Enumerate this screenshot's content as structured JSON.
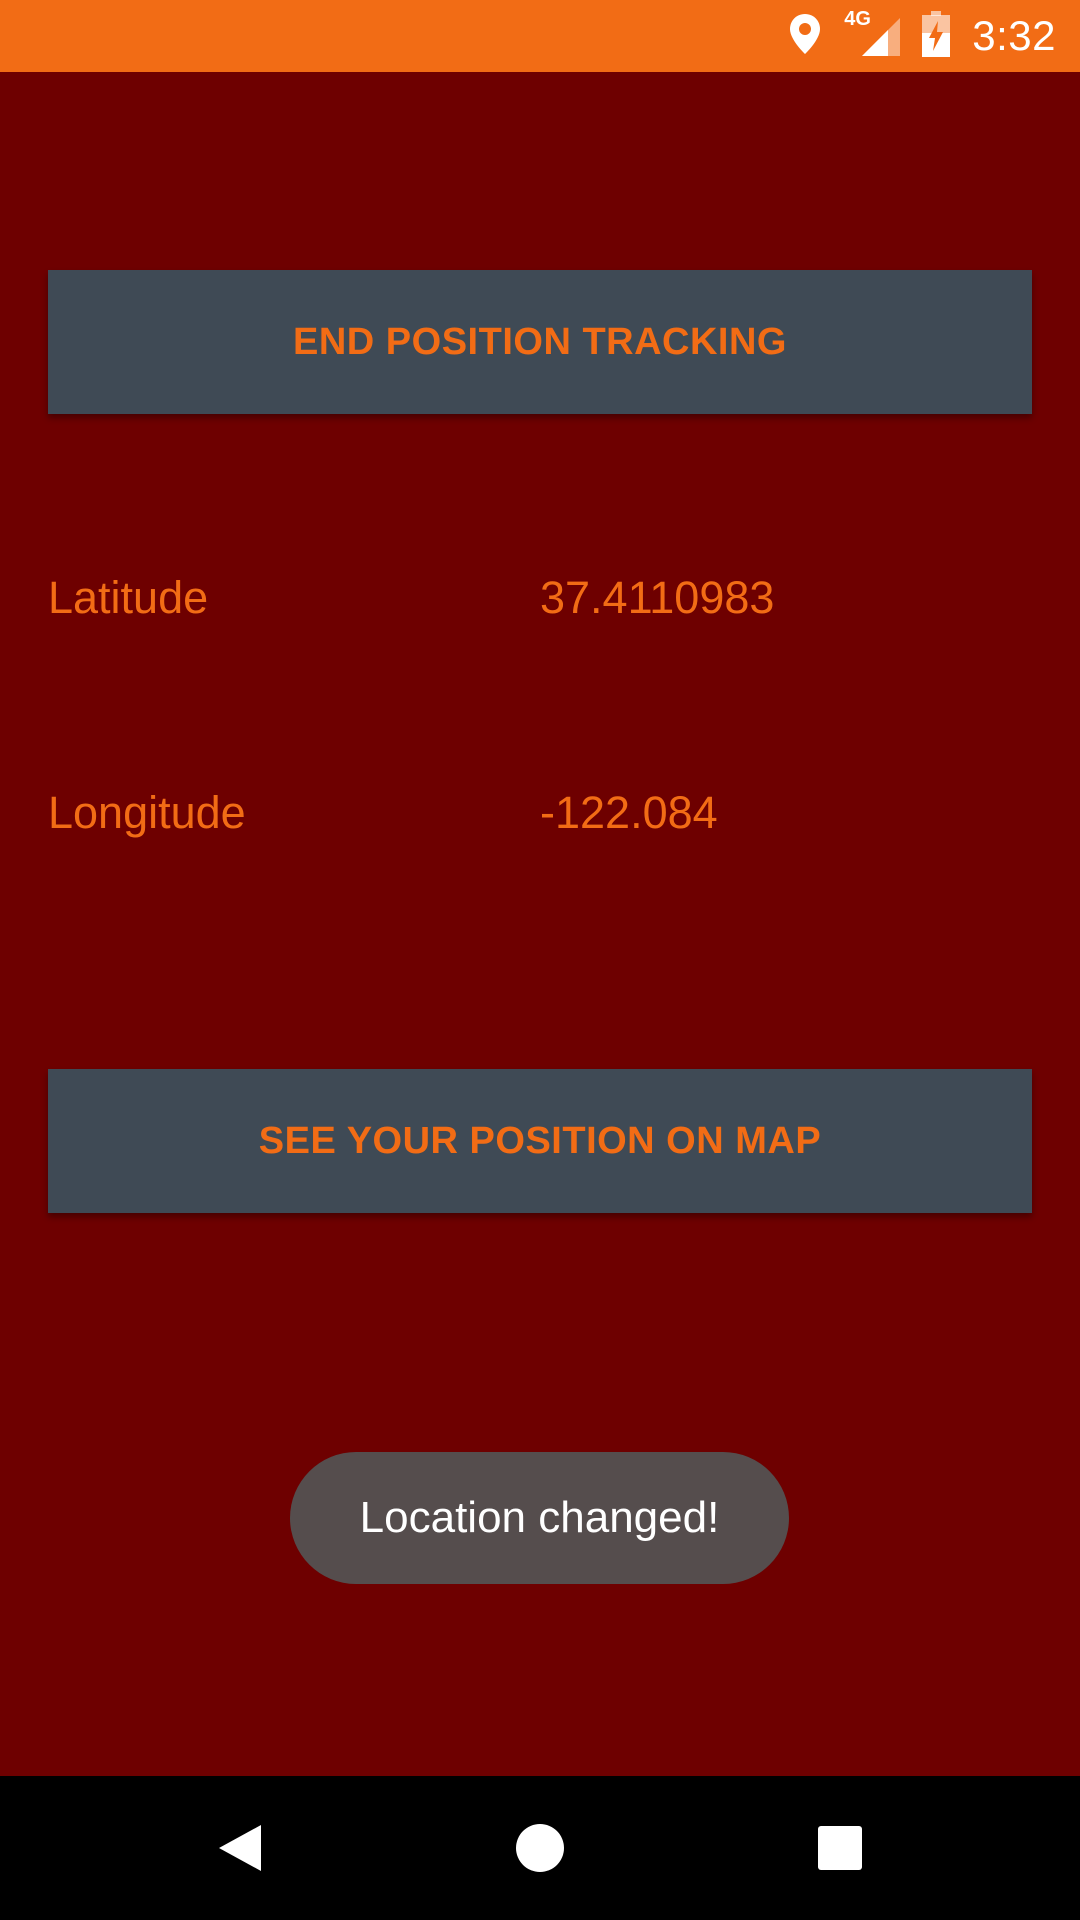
{
  "status_bar": {
    "time": "3:32",
    "network": "4G",
    "background_color": "#f26c15",
    "icons": [
      "location-pin-icon",
      "signal-icon",
      "battery-charging-icon"
    ]
  },
  "buttons": {
    "end_tracking": "END POSITION TRACKING",
    "see_map": "SEE YOUR POSITION ON MAP"
  },
  "coordinates": {
    "latitude_label": "Latitude",
    "latitude_value": "37.4110983",
    "longitude_label": "Longitude",
    "longitude_value": "-122.084"
  },
  "toast": {
    "message": "Location changed!"
  },
  "nav_bar": {
    "icons": [
      "back-icon",
      "home-icon",
      "recents-icon"
    ]
  },
  "colors": {
    "background": "#6e0000",
    "accent": "#f26c15",
    "button_bg": "#3f4a55",
    "toast_bg": "#554d4d"
  }
}
